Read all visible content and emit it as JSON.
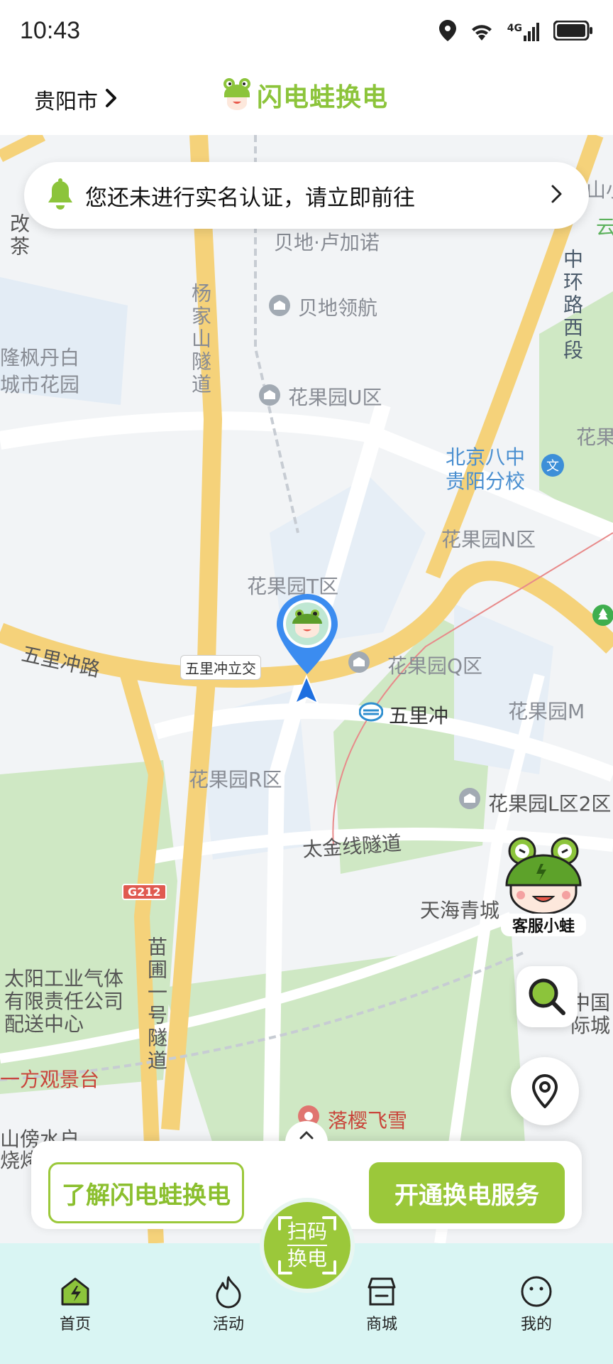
{
  "status_bar": {
    "time": "10:43",
    "network": "4G"
  },
  "header": {
    "city": "贵阳市",
    "brand_name": "闪电蛙换电"
  },
  "notice": {
    "text": "您还未进行实名认证，请立即前往"
  },
  "map": {
    "labels": {
      "beidi_lujianuo": "贝地·卢加诺",
      "beidi_linghang": "贝地领航",
      "yangjiashan": "杨家山隧道",
      "longfeng": "隆枫丹白",
      "longfeng2": "城市花园",
      "hgy_u": "花果园U区",
      "zhonghuan": "中环路西段",
      "bj8": "北京八中",
      "bj8b": "贵阳分校",
      "hgy_n": "花果园N区",
      "hgy_t": "花果园T区",
      "wulichong_lijiao": "五里冲立交",
      "wulichong_lu": "五里冲路",
      "hgy_q": "花果园Q区",
      "wulichong": "五里冲",
      "hgy_m": "花果园M",
      "hgy_r": "花果园R区",
      "hgy_l": "花果园L区2区",
      "taijin": "太金线隧道",
      "g212": "G212",
      "tianhai": "天海青城",
      "miaopu": "苗圃一号隧道",
      "taiyang1": "太阳工业气体",
      "taiyang2": "有限责任公司",
      "taiyang3": "配送中心",
      "yifang": "一方观景台",
      "luoying": "落樱飞雪",
      "shanbang1": "山傍水户",
      "shanbang2": "烧烤",
      "zhongguo1": "中国",
      "zhongguo2": "际城",
      "hua": "花果",
      "yun": "云",
      "shanxiao": "山小",
      "gaipart": "改茶"
    }
  },
  "service": {
    "label": "客服小蛙"
  },
  "actions": {
    "learn": "了解闪电蛙换电",
    "open": "开通换电服务"
  },
  "scan": {
    "line1": "扫码",
    "line2": "换电"
  },
  "nav": {
    "home": "首页",
    "activity": "活动",
    "mall": "商城",
    "mine": "我的"
  }
}
